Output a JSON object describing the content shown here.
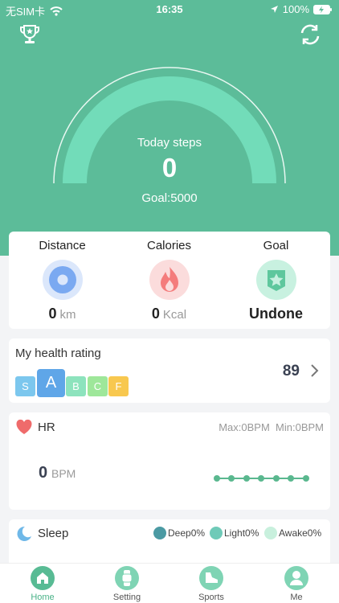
{
  "status_bar": {
    "carrier": "无SIM卡",
    "time": "16:35",
    "battery": "100%"
  },
  "header": {
    "left_icon": "trophy-icon",
    "right_icon": "sync-icon"
  },
  "steps": {
    "label": "Today steps",
    "value": "0",
    "goal": "Goal:5000"
  },
  "stats": [
    {
      "title": "Distance",
      "value": "0",
      "unit": "km",
      "icon": "location-icon"
    },
    {
      "title": "Calories",
      "value": "0",
      "unit": "Kcal",
      "icon": "flame-icon"
    },
    {
      "title": "Goal",
      "value": "Undone",
      "unit": "",
      "icon": "star-badge-icon"
    }
  ],
  "health_rating": {
    "title": "My health rating",
    "score": "89",
    "grades": [
      "S",
      "A",
      "B",
      "C",
      "F"
    ],
    "selected": "A",
    "grade_colors": [
      "#7cc7ee",
      "#5fa6e8",
      "#8de3bd",
      "#9ee79a",
      "#f8c84f"
    ]
  },
  "heart_rate": {
    "title": "HR",
    "max": "Max:0BPM",
    "min": "Min:0BPM",
    "value": "0",
    "unit": "BPM"
  },
  "sleep": {
    "title": "Sleep",
    "legend": [
      {
        "label": "Deep0%",
        "color": "#4b9aa3"
      },
      {
        "label": "Light0%",
        "color": "#6fcab8"
      },
      {
        "label": "Awake0%",
        "color": "#c8f0dd"
      }
    ]
  },
  "tabs": [
    {
      "label": "Home",
      "icon": "home-icon"
    },
    {
      "label": "Setting",
      "icon": "watch-icon"
    },
    {
      "label": "Sports",
      "icon": "shoe-icon"
    },
    {
      "label": "Me",
      "icon": "person-icon"
    }
  ],
  "colors": {
    "brand": "#5cbc99",
    "arc": "#6fdbb8",
    "accent": "#49b287"
  }
}
